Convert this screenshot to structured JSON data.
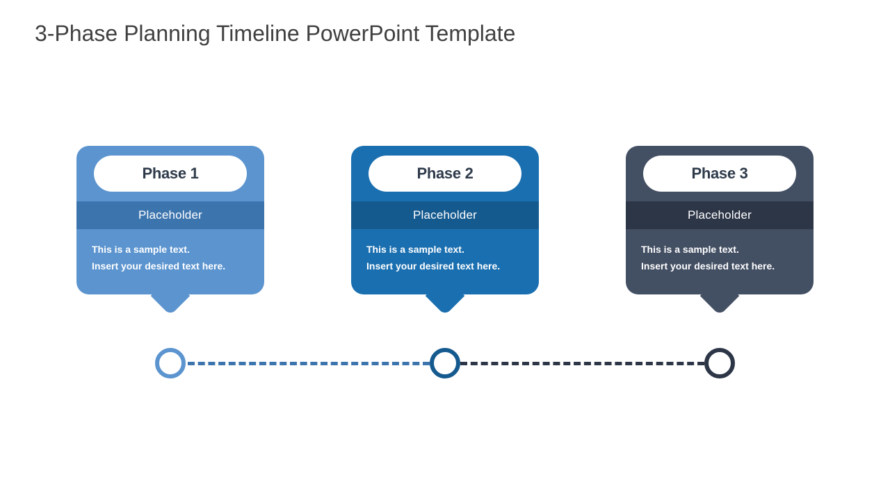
{
  "title": "3-Phase Planning Timeline PowerPoint Template",
  "phases": [
    {
      "name": "Phase 1",
      "subtitle": "Placeholder",
      "line1": "This is a sample text.",
      "line2": "Insert your desired text here.",
      "color": "#5b94cf",
      "accent": "#3c74ae"
    },
    {
      "name": "Phase 2",
      "subtitle": "Placeholder",
      "line1": "This is a sample text.",
      "line2": "Insert your desired text here.",
      "color": "#1a6fb0",
      "accent": "#155a8f"
    },
    {
      "name": "Phase 3",
      "subtitle": "Placeholder",
      "line1": "This is a sample text.",
      "line2": "Insert your desired text here.",
      "color": "#434f63",
      "accent": "#2d3647"
    }
  ]
}
